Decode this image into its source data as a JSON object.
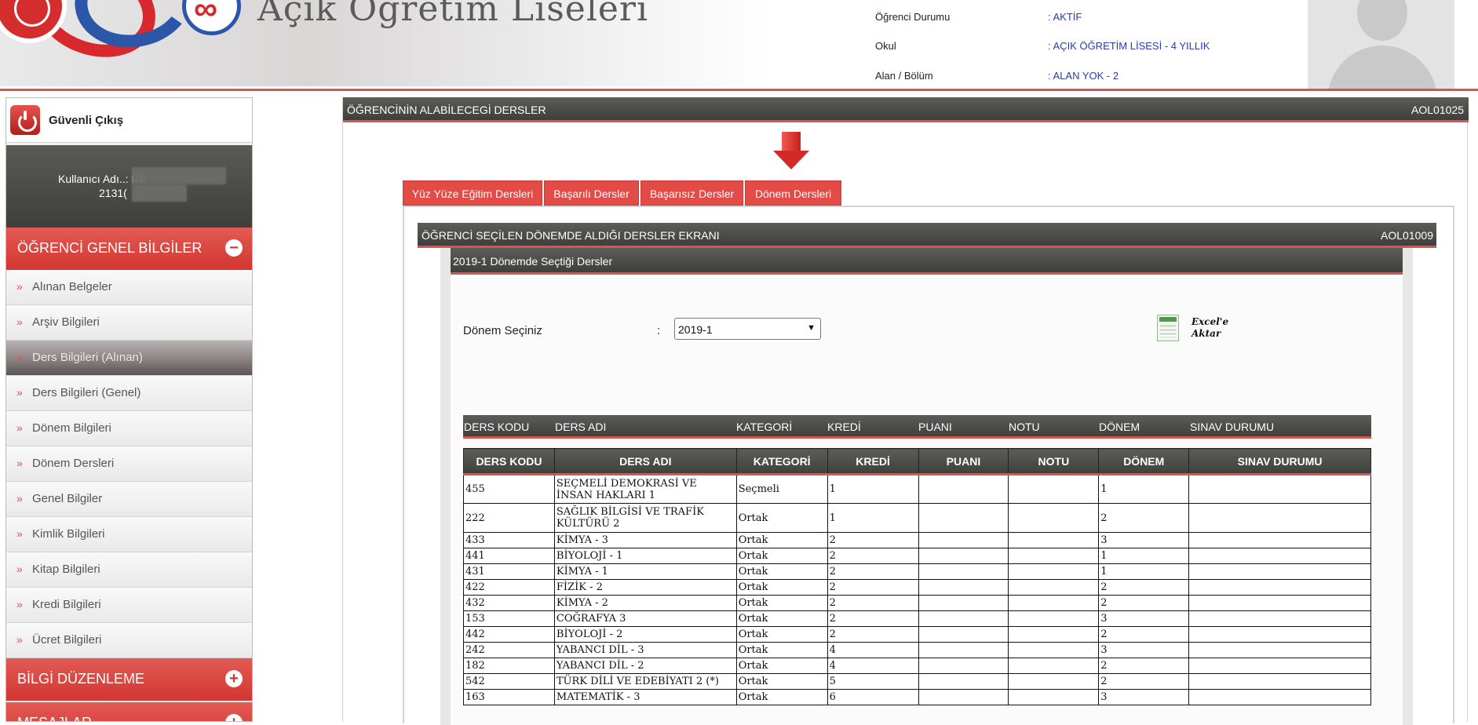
{
  "header": {
    "site_title": "Açık Öğretim Liseleri",
    "status": [
      {
        "label": "Öğrenci Durumu",
        "value": ": AKTİF"
      },
      {
        "label": "Okul",
        "value": ": AÇIK ÖĞRETİM LİSESİ - 4 YILLIK"
      },
      {
        "label": "Alan / Bölüm",
        "value": ": ALAN YOK - 2"
      }
    ]
  },
  "sidebar": {
    "logout_label": "Güvenli Çıkış",
    "user_line1": "Kullanıcı Adı..: RE",
    "user_line2": "2131(",
    "sections": [
      {
        "title": "ÖĞRENCİ GENEL BİLGİLER",
        "toggle": "−"
      },
      {
        "title": "BİLGİ DÜZENLEME",
        "toggle": "+"
      },
      {
        "title": "MESAJLAR",
        "toggle": "+"
      }
    ],
    "items": [
      {
        "label": "Alınan Belgeler"
      },
      {
        "label": "Arşiv Bilgileri"
      },
      {
        "label": "Ders Bilgileri (Alınan)"
      },
      {
        "label": "Ders Bilgileri (Genel)"
      },
      {
        "label": "Dönem Bilgileri"
      },
      {
        "label": "Dönem Dersleri"
      },
      {
        "label": "Genel Bilgiler"
      },
      {
        "label": "Kimlik Bilgileri"
      },
      {
        "label": "Kitap Bilgileri"
      },
      {
        "label": "Kredi Bilgileri"
      },
      {
        "label": "Ücret Bilgileri"
      }
    ],
    "chevron": "»"
  },
  "main": {
    "panel_title": "ÖĞRENCİNİN ALABİLECEGİ DERSLER",
    "panel_code": "AOL01025",
    "tabs": [
      {
        "label": "Yüz Yüze Eğitim Dersleri"
      },
      {
        "label": "Başarılı Dersler"
      },
      {
        "label": "Başarısız Dersler"
      },
      {
        "label": "Dönem Dersleri"
      }
    ],
    "inner_title": "ÖĞRENCİ SEÇİLEN DÖNEMDE ALDIĞI DERSLER EKRANI",
    "inner_code": "AOL01009",
    "sub_title": "2019-1 Dönemde Seçtiği Dersler",
    "period_label": "Dönem Seçiniz",
    "period_colon": ":",
    "period_value": "2019-1",
    "period_caret": "▼",
    "excel_line1": "Excel'e",
    "excel_line2": "Aktar"
  },
  "table": {
    "columns": [
      "DERS KODU",
      "DERS ADI",
      "KATEGORİ",
      "KREDİ",
      "PUANI",
      "NOTU",
      "DÖNEM",
      "SINAV DURUMU"
    ],
    "rows": [
      [
        "455",
        "SEÇMELİ DEMOKRASİ VE İNSAN HAKLARI 1",
        "Seçmeli",
        "1",
        "",
        "",
        "1",
        ""
      ],
      [
        "222",
        "SAĞLIK BİLGİSİ VE TRAFİK KÜLTÜRÜ 2",
        "Ortak",
        "1",
        "",
        "",
        "2",
        ""
      ],
      [
        "433",
        "KİMYA - 3",
        "Ortak",
        "2",
        "",
        "",
        "3",
        ""
      ],
      [
        "441",
        "BİYOLOJİ - 1",
        "Ortak",
        "2",
        "",
        "",
        "1",
        ""
      ],
      [
        "431",
        "KİMYA - 1",
        "Ortak",
        "2",
        "",
        "",
        "1",
        ""
      ],
      [
        "422",
        "FİZİK - 2",
        "Ortak",
        "2",
        "",
        "",
        "2",
        ""
      ],
      [
        "432",
        "KİMYA - 2",
        "Ortak",
        "2",
        "",
        "",
        "2",
        ""
      ],
      [
        "153",
        "COĞRAFYA 3",
        "Ortak",
        "2",
        "",
        "",
        "3",
        ""
      ],
      [
        "442",
        "BİYOLOJİ - 2",
        "Ortak",
        "2",
        "",
        "",
        "2",
        ""
      ],
      [
        "242",
        "YABANCI DİL - 3",
        "Ortak",
        "4",
        "",
        "",
        "3",
        ""
      ],
      [
        "182",
        "YABANCI DİL - 2",
        "Ortak",
        "4",
        "",
        "",
        "2",
        ""
      ],
      [
        "542",
        "TÜRK DİLİ VE EDEBİYATI 2 (*)",
        "Ortak",
        "5",
        "",
        "",
        "2",
        ""
      ],
      [
        "163",
        "MATEMATİK - 3",
        "Ortak",
        "6",
        "",
        "",
        "3",
        ""
      ]
    ]
  },
  "colors": {
    "accent": "#e24b46",
    "bar": "#4a4a46",
    "link": "#2b3aa8"
  }
}
